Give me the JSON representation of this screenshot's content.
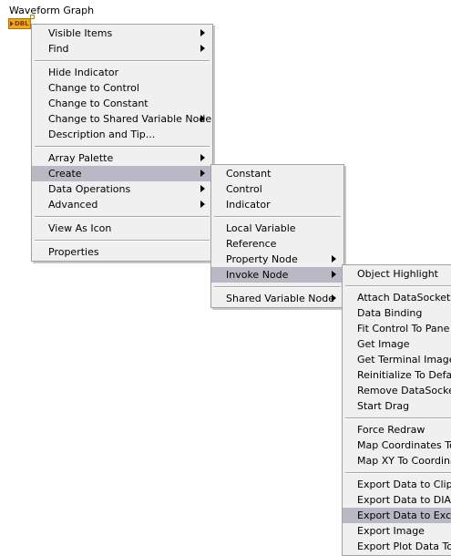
{
  "header": {
    "title": "Waveform Graph",
    "terminal_label": "DBL"
  },
  "main_menu": {
    "groups": [
      [
        {
          "label": "Visible Items",
          "submenu": true
        },
        {
          "label": "Find",
          "submenu": true
        }
      ],
      [
        {
          "label": "Hide Indicator"
        },
        {
          "label": "Change to Control"
        },
        {
          "label": "Change to Constant"
        },
        {
          "label": "Change to Shared Variable Node",
          "submenu": true
        },
        {
          "label": "Description and Tip..."
        }
      ],
      [
        {
          "label": "Array Palette",
          "submenu": true
        },
        {
          "label": "Create",
          "submenu": true,
          "highlighted": true
        },
        {
          "label": "Data Operations",
          "submenu": true
        },
        {
          "label": "Advanced",
          "submenu": true
        }
      ],
      [
        {
          "label": "View As Icon"
        }
      ],
      [
        {
          "label": "Properties"
        }
      ]
    ]
  },
  "create_menu": {
    "groups": [
      [
        {
          "label": "Constant"
        },
        {
          "label": "Control"
        },
        {
          "label": "Indicator"
        }
      ],
      [
        {
          "label": "Local Variable"
        },
        {
          "label": "Reference"
        },
        {
          "label": "Property Node",
          "submenu": true
        },
        {
          "label": "Invoke Node",
          "submenu": true,
          "highlighted": true
        }
      ],
      [
        {
          "label": "Shared Variable Node",
          "submenu": true
        }
      ]
    ]
  },
  "invoke_menu": {
    "groups": [
      [
        {
          "label": "Object Highlight"
        }
      ],
      [
        {
          "label": "Attach DataSocket"
        },
        {
          "label": "Data Binding"
        },
        {
          "label": "Fit Control To Pane"
        },
        {
          "label": "Get Image"
        },
        {
          "label": "Get Terminal Image"
        },
        {
          "label": "Reinitialize To Default"
        },
        {
          "label": "Remove DataSocket"
        },
        {
          "label": "Start Drag"
        }
      ],
      [
        {
          "label": "Force Redraw"
        },
        {
          "label": "Map Coordinates To XY"
        },
        {
          "label": "Map XY To Coordinates"
        }
      ],
      [
        {
          "label": "Export Data to Clipboard"
        },
        {
          "label": "Export Data to DIAdem"
        },
        {
          "label": "Export Data to Excel",
          "highlighted": true
        },
        {
          "label": "Export Image"
        },
        {
          "label": "Export Plot Data To Clipboard"
        }
      ]
    ]
  }
}
